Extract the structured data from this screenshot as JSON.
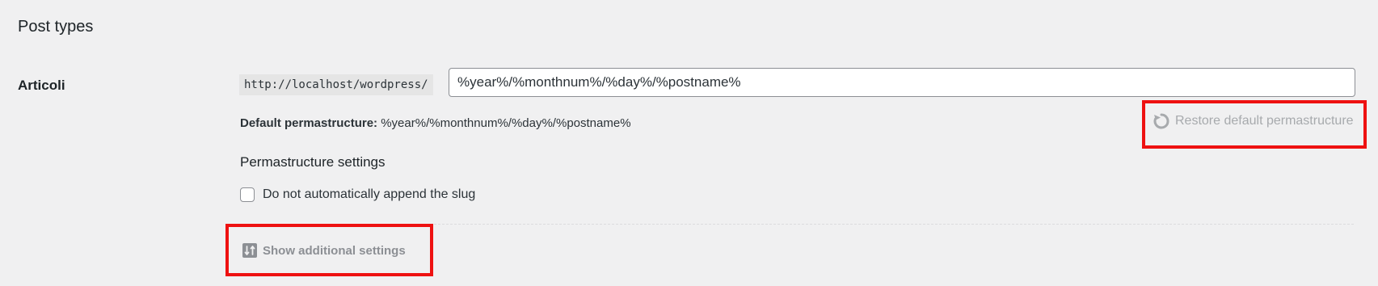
{
  "section": {
    "title": "Post types"
  },
  "post_type": {
    "label": "Articoli",
    "url_prefix": "http://localhost/wordpress/",
    "permastructure_value": "%year%/%monthnum%/%day%/%postname%",
    "default_label": "Default permastructure:",
    "default_value": "%year%/%monthnum%/%day%/%postname%",
    "restore_label": "Restore default permastructure",
    "restore_icon": "undo-icon"
  },
  "settings": {
    "heading": "Permastructure settings",
    "checkbox_label": "Do not automatically append the slug",
    "checkbox_checked": false,
    "show_additional_label": "Show additional settings",
    "show_additional_icon": "settings-sliders-icon"
  },
  "colors": {
    "highlight": "#ee1111",
    "background": "#f0f0f1",
    "muted_text": "#a7aaad"
  }
}
